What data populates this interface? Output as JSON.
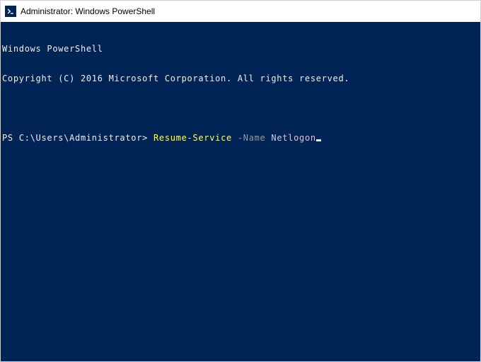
{
  "window": {
    "title": "Administrator: Windows PowerShell",
    "icon": "powershell-icon"
  },
  "terminal": {
    "header_line1": "Windows PowerShell",
    "header_line2": "Copyright (C) 2016 Microsoft Corporation. All rights reserved.",
    "prompt": "PS C:\\Users\\Administrator> ",
    "command_cmdlet": "Resume-Service",
    "command_flag": " -Name",
    "command_arg": " Netlogon",
    "colors": {
      "background": "#012456",
      "foreground": "#c0c0c0",
      "cmdlet": "#ffff66",
      "flag": "#9a9a9a",
      "arg": "#d0c8e0"
    }
  }
}
